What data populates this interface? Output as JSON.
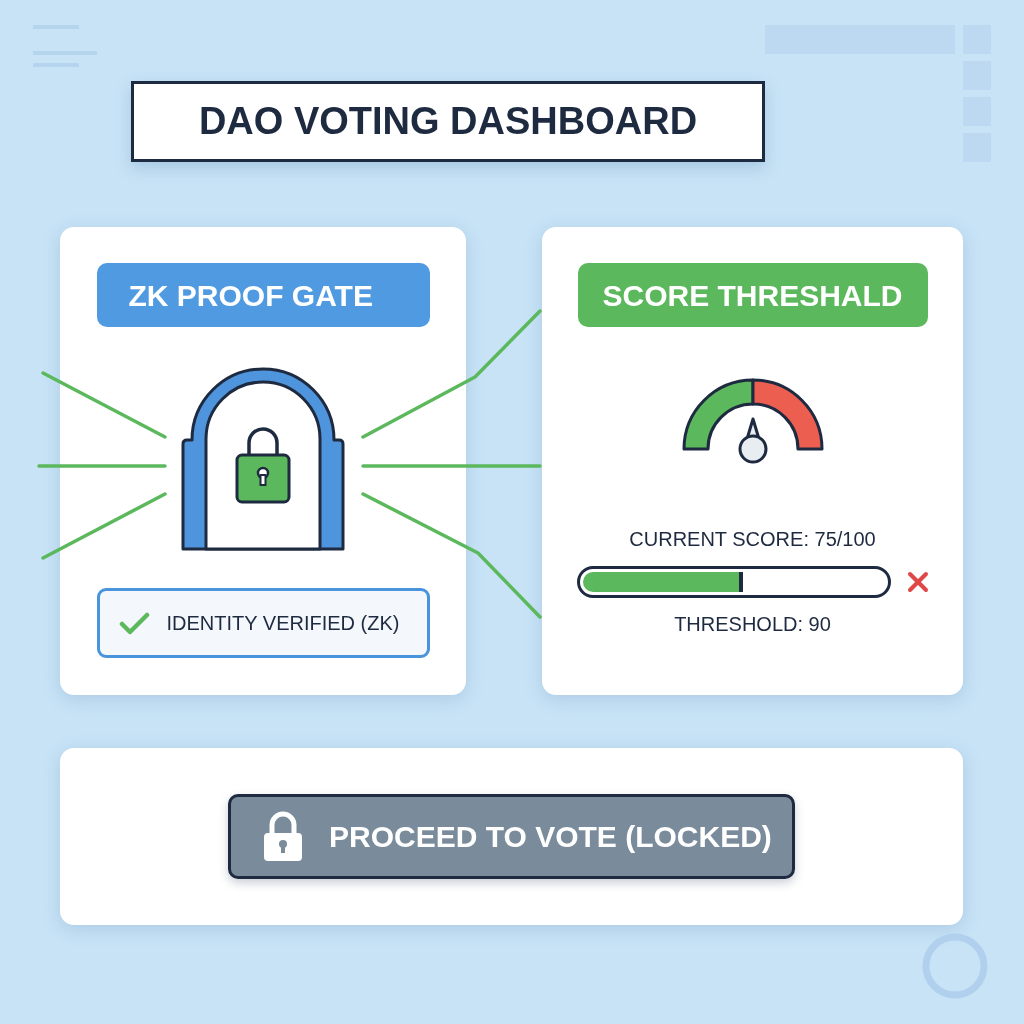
{
  "header": {
    "title": "DAO VOTING DASHBOARD"
  },
  "gate_card": {
    "heading": "ZK PROOF GATE",
    "status": {
      "label": "IDENTITY VERIFIED (ZK)",
      "verified": true
    }
  },
  "score_card": {
    "heading": "SCORE THRESHALD",
    "current_score": "CURRENT SCORE: 75/100",
    "progress": {
      "level": 0.53,
      "passed": false
    },
    "threshold": "THRESHOLD: 90"
  },
  "action_card": {
    "button": {
      "label": "PROCEED TO VOTE (LOCKED)",
      "locked": true
    }
  }
}
